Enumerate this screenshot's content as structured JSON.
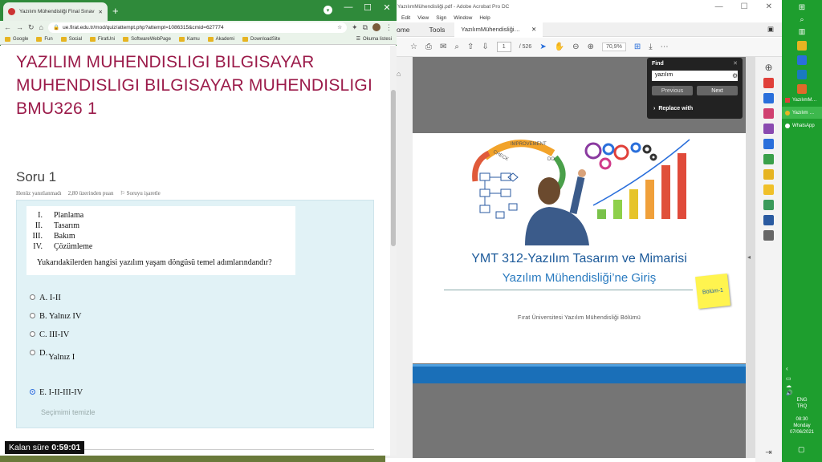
{
  "chrome": {
    "tab_title": "Yazılım Mühendisliği Final Sınav…",
    "url": "ue.firat.edu.tr/mod/quiz/attempt.php?attempt=1086315&cmid=627774",
    "bookmarks": [
      "Google",
      "Fun",
      "Social",
      "FiratUni",
      "SoftwareWebPage",
      "Kamu",
      "Akademi",
      "DownloadSite"
    ],
    "reading_list": "Okuma listesi"
  },
  "quiz": {
    "course_title": "YAZILIM MUHENDISLIGI BILGISAYAR MUHENDISLIGI BILGISAYAR MUHENDISLIGI BMU326 1",
    "question_title": "Soru 1",
    "status": "Henüz yanıtlanmadı",
    "points": "2,80 üzerinden puan",
    "flag": "Soruyu işaretle",
    "items": [
      {
        "num": "I.",
        "text": "Planlama"
      },
      {
        "num": "II.",
        "text": "Tasarım"
      },
      {
        "num": "III.",
        "text": "Bakım"
      },
      {
        "num": "IV.",
        "text": "Çözümleme"
      }
    ],
    "question_text": "Yukarıdakilerden hangisi yazılım yaşam döngüsü temel adımlarındandır?",
    "options": [
      {
        "label": "A. I-II"
      },
      {
        "label": "B. Yalnız IV"
      },
      {
        "label": "C. III-IV"
      },
      {
        "label": "D.",
        "extra": "Yalnız I"
      },
      {
        "label": "E. I-II-III-IV",
        "selected": true
      }
    ],
    "clear_choice": "Seçimimi temizle",
    "timer_label": "Kalan süre",
    "timer_value": "0:59:01"
  },
  "acrobat": {
    "window_title": "YazılımMühendisliği.pdf - Adobe Acrobat Pro DC",
    "menu": [
      "Edit",
      "View",
      "Sign",
      "Window",
      "Help"
    ],
    "tabs": {
      "home": "ome",
      "tools": "Tools",
      "doc": "YazılımMühendisliği…"
    },
    "page_current": "1",
    "page_total": "/ 526",
    "zoom": "70,9%",
    "find": {
      "title": "Find",
      "query": "yazılım",
      "prev": "Previous",
      "next": "Next",
      "replace": "Replace with"
    },
    "slide": {
      "title1": "YMT 312-Yazılım Tasarım ve Mimarisi",
      "title2": "Yazılım Mühendisliği’ne Giriş",
      "badge": "Bölüm-1",
      "university": "Fırat Üniversitesi Yazılım Mühendisliği Bölümü",
      "improvement": "IMPROVEMENT",
      "check": "CHECK",
      "do": "DO"
    }
  },
  "taskbar": {
    "apps": [
      "YazılımM…",
      "Yazılım …",
      "WhatsApp"
    ],
    "lang": [
      "ENG",
      "TRQ"
    ],
    "time": "08:30",
    "day": "Monday",
    "date": "07/06/2021"
  }
}
